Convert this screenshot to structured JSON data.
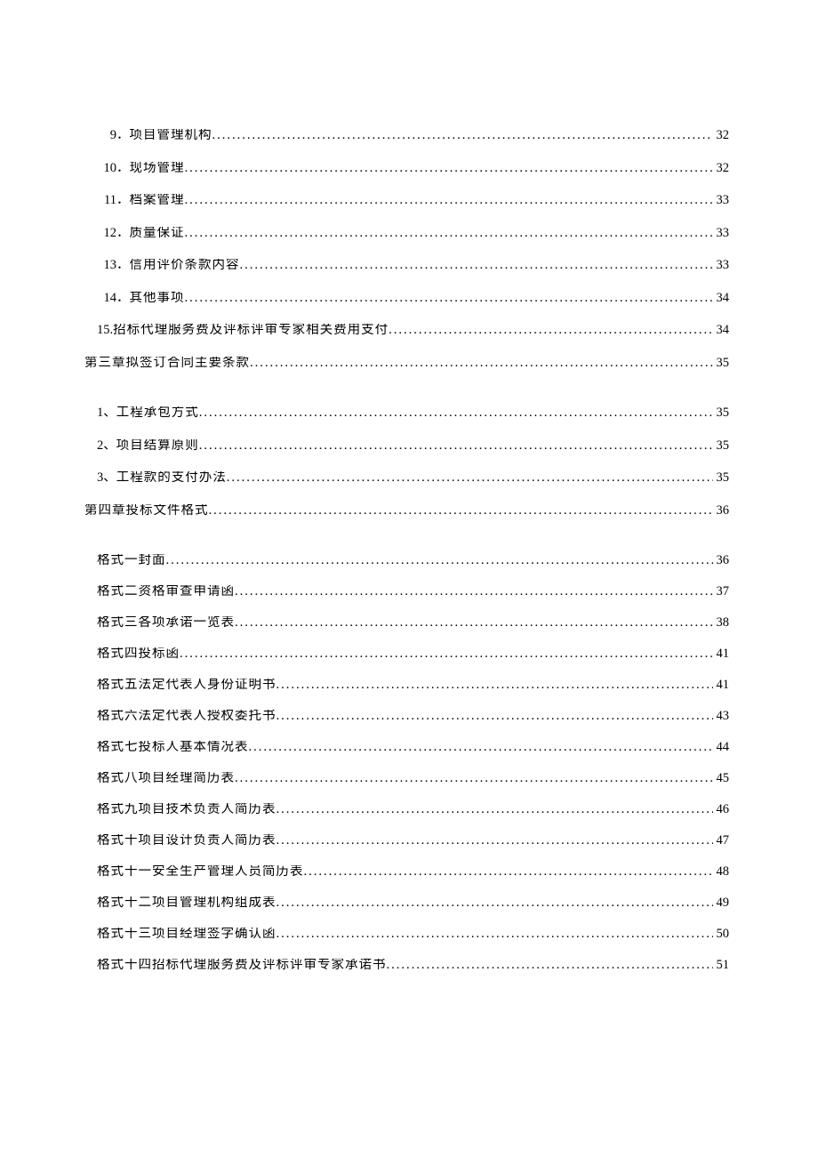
{
  "section_items": [
    {
      "num": "9",
      "sep": " ．",
      "label": "项目管理机构",
      "page": "32",
      "numw": "22px"
    },
    {
      "num": "10",
      "sep": " ．",
      "label": "现场管理",
      "page": "32",
      "numw": "22px"
    },
    {
      "num": "11",
      "sep": " ．",
      "label": "档案管理",
      "page": "33",
      "numw": "22px"
    },
    {
      "num": "12",
      "sep": " ．",
      "label": "质量保证",
      "page": "33",
      "numw": "22px"
    },
    {
      "num": "13",
      "sep": " ．",
      "label": "信用评价条款内容",
      "page": "33",
      "numw": "22px"
    },
    {
      "num": "14",
      "sep": " ．",
      "label": "其他事项",
      "page": "34",
      "numw": "22px"
    },
    {
      "num": "15.",
      "sep": "",
      "label": "招标代理服务费及评标评审专家相关费用支付",
      "page": "34",
      "numw": "auto"
    }
  ],
  "chapter3": {
    "label": "第三章拟签订合同主要条款",
    "page": "35"
  },
  "chapter3_items": [
    {
      "num": "1、",
      "label": "工程承包方式",
      "page": "35"
    },
    {
      "num": "2、",
      "label": "项目结算原则",
      "page": "35"
    },
    {
      "num": "3、",
      "label": "工程款的支付办法",
      "page": "35"
    }
  ],
  "chapter4": {
    "label": "第四章投标文件格式",
    "page": "36"
  },
  "chapter4_items": [
    {
      "label": "格式一封面",
      "page": "36"
    },
    {
      "label": "格式二资格审查申请函",
      "page": "37"
    },
    {
      "label": "格式三各项承诺一览表",
      "page": "38"
    },
    {
      "label": "格式四投标函",
      "page": "41"
    },
    {
      "label": "格式五法定代表人身份证明书",
      "page": "41"
    },
    {
      "label": "格式六法定代表人授权委托书",
      "page": "43"
    },
    {
      "label": "格式七投标人基本情况表",
      "page": "44"
    },
    {
      "label": "格式八项目经理简历表",
      "page": "45"
    },
    {
      "label": "格式九项目技术负责人简历表",
      "page": "46"
    },
    {
      "label": "格式十项目设计负责人简历表",
      "page": "47"
    },
    {
      "label": "格式十一安全生产管理人员简历表",
      "page": "48"
    },
    {
      "label": "格式十二项目管理机构组成表",
      "page": "49"
    },
    {
      "label": "格式十三项目经理签字确认函",
      "page": "50"
    },
    {
      "label": "格式十四招标代理服务费及评标评审专家承诺书",
      "page": "51"
    }
  ]
}
